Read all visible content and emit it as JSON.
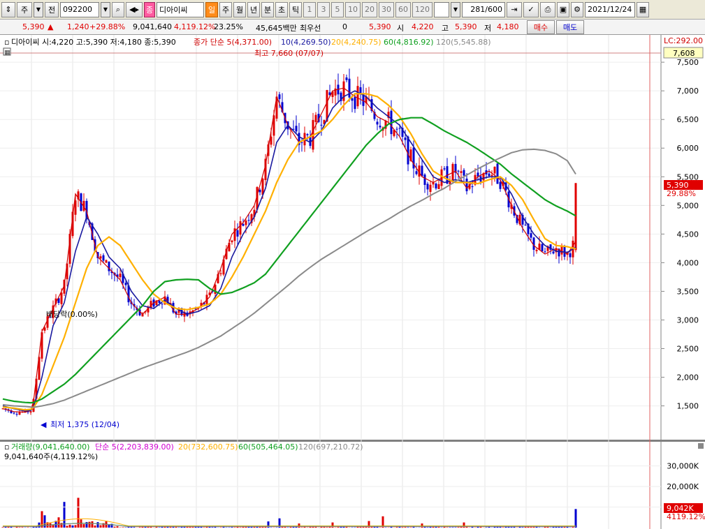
{
  "toolbar": {
    "market": "주",
    "jeon": "전",
    "code": "092200",
    "sector_badge": "종",
    "name": "디아이씨",
    "periods": [
      "일",
      "주",
      "월",
      "년",
      "분",
      "초",
      "틱"
    ],
    "minutes": [
      "1",
      "3",
      "5",
      "10",
      "20",
      "30",
      "60",
      "120"
    ],
    "count": "281",
    "count_total": "/600",
    "date": "2021/12/24"
  },
  "quote": {
    "price": "5,390",
    "change": "1,240",
    "change_pct": "+29.88%",
    "volume": "9,041,640",
    "vol_ratio": "4,119.12%",
    "turnover": "23.25%",
    "amount": "45,645백만",
    "best_label": "최우선",
    "best_value": "0",
    "last": "5,390",
    "open_label": "시",
    "open": "4,220",
    "high_label": "고",
    "high": "5,390",
    "low_label": "저",
    "low": "4,180",
    "buy_button": "매수",
    "sell_button": "매도"
  },
  "price_panel": {
    "title": "디아이씨 시:4,220 고:5,390 저:4,180 종:5,390",
    "ma5": "종가 단순 5(4,371.00)",
    "ma10": "10(4,269.50)",
    "ma20": "20(4,240.75)",
    "ma60": "60(4,816.92)",
    "ma120": "120(5,545.88)",
    "lc_label": "LC:292.00",
    "hi_marker": "7,608",
    "high_annotation": "최고 7,660 (07/07)",
    "low_annotation": "최저 1,375 (12/04)",
    "dividend_annotation": "배당락(0.00%)",
    "price_badge": "5,390",
    "price_badge_pct": "29.88%",
    "y_ticks": [
      "7,500",
      "7,000",
      "6,500",
      "6,000",
      "5,500",
      "5,000",
      "4,500",
      "4,000",
      "3,500",
      "3,000",
      "2,500",
      "2,000",
      "1,500"
    ]
  },
  "volume_panel": {
    "title": "거래량(9,041,640.00)",
    "ma5": "단순 5(2,203,839.00)",
    "ma20": "20(732,600.75)",
    "ma60": "60(505,464.05)",
    "ma120": "120(697,210.72)",
    "current": "9,041,640주(4,119.12%)",
    "y_ticks": [
      "30,000K",
      "20,000K",
      "10,000K"
    ],
    "badge": "9,042K",
    "badge_pct": "4119.12%"
  },
  "colors": {
    "up": "#e00000",
    "down": "#0000d0",
    "ma5": "#d00000",
    "ma10": "#1a1aa0",
    "ma20": "#ffb000",
    "ma60": "#10a020",
    "ma120": "#8a8a8a",
    "badge": "#e00000",
    "hi_marker_bg": "#ffffc0"
  },
  "chart_data": {
    "type": "candlestick",
    "ylim": [
      1300,
      7660
    ],
    "high": 7660,
    "low": 1375,
    "close": 5390,
    "ma_anchor": [
      [
        0,
        1450,
        1500,
        1480,
        1620,
        1520
      ],
      [
        4,
        1400,
        1450,
        1460,
        1580,
        1500
      ],
      [
        8,
        1390,
        1410,
        1430,
        1560,
        1490
      ],
      [
        10,
        1420,
        1420,
        1440,
        1555,
        1480
      ],
      [
        11,
        1580,
        1480,
        1470,
        1560,
        1475
      ],
      [
        14,
        2800,
        2000,
        1700,
        1620,
        1500
      ],
      [
        18,
        3200,
        2900,
        2200,
        1750,
        1540
      ],
      [
        22,
        3600,
        3300,
        2700,
        1880,
        1600
      ],
      [
        26,
        5200,
        4200,
        3300,
        2050,
        1680
      ],
      [
        30,
        4900,
        4800,
        3900,
        2250,
        1760
      ],
      [
        34,
        4100,
        4500,
        4300,
        2450,
        1840
      ],
      [
        38,
        3900,
        4100,
        4450,
        2650,
        1920
      ],
      [
        42,
        3700,
        3900,
        4300,
        2850,
        2000
      ],
      [
        46,
        3300,
        3500,
        4000,
        3050,
        2080
      ],
      [
        50,
        3100,
        3250,
        3700,
        3250,
        2160
      ],
      [
        54,
        3300,
        3200,
        3450,
        3500,
        2230
      ],
      [
        58,
        3400,
        3350,
        3300,
        3670,
        2300
      ],
      [
        62,
        3100,
        3200,
        3200,
        3700,
        2370
      ],
      [
        66,
        3100,
        3100,
        3180,
        3710,
        2440
      ],
      [
        70,
        3200,
        3150,
        3220,
        3700,
        2520
      ],
      [
        74,
        3400,
        3250,
        3280,
        3550,
        2620
      ],
      [
        78,
        3900,
        3550,
        3450,
        3450,
        2720
      ],
      [
        82,
        4500,
        4100,
        3750,
        3480,
        2850
      ],
      [
        86,
        4700,
        4500,
        4100,
        3560,
        2980
      ],
      [
        90,
        5000,
        4800,
        4500,
        3650,
        3120
      ],
      [
        94,
        5700,
        5300,
        4900,
        3800,
        3280
      ],
      [
        98,
        6900,
        6100,
        5400,
        4050,
        3440
      ],
      [
        102,
        6400,
        6400,
        5800,
        4300,
        3600
      ],
      [
        106,
        6100,
        6200,
        6100,
        4550,
        3770
      ],
      [
        110,
        6200,
        6100,
        6200,
        4800,
        3920
      ],
      [
        114,
        6600,
        6300,
        6300,
        5050,
        4060
      ],
      [
        118,
        7000,
        6700,
        6500,
        5300,
        4180
      ],
      [
        122,
        7050,
        6900,
        6750,
        5550,
        4300
      ],
      [
        126,
        6900,
        7000,
        6950,
        5800,
        4420
      ],
      [
        130,
        6800,
        6900,
        6950,
        6050,
        4540
      ],
      [
        134,
        6550,
        6700,
        6900,
        6250,
        4650
      ],
      [
        138,
        6450,
        6550,
        6750,
        6420,
        4760
      ],
      [
        142,
        6200,
        6400,
        6550,
        6500,
        4880
      ],
      [
        146,
        5800,
        6100,
        6250,
        6530,
        4990
      ],
      [
        150,
        5500,
        5800,
        5900,
        6530,
        5090
      ],
      [
        154,
        5400,
        5500,
        5600,
        6420,
        5200
      ],
      [
        158,
        5500,
        5400,
        5480,
        6300,
        5300
      ],
      [
        162,
        5600,
        5450,
        5400,
        6200,
        5420
      ],
      [
        166,
        5300,
        5400,
        5400,
        6100,
        5530
      ],
      [
        170,
        5500,
        5450,
        5380,
        5980,
        5640
      ],
      [
        174,
        5600,
        5500,
        5450,
        5850,
        5740
      ],
      [
        178,
        5450,
        5500,
        5500,
        5720,
        5830
      ],
      [
        182,
        5000,
        5200,
        5350,
        5550,
        5920
      ],
      [
        186,
        4600,
        4800,
        5100,
        5400,
        5970
      ],
      [
        190,
        4300,
        4500,
        4750,
        5250,
        5980
      ],
      [
        194,
        4150,
        4300,
        4420,
        5100,
        5960
      ],
      [
        198,
        4250,
        4200,
        4300,
        4990,
        5900
      ],
      [
        202,
        4150,
        4180,
        4280,
        4900,
        5780
      ],
      [
        205,
        4371,
        4270,
        4241,
        4817,
        5546
      ]
    ],
    "series": [
      {
        "name": "종가 단순 5(4,371.00)",
        "field": 1
      },
      {
        "name": "10(4,269.50)",
        "field": 2
      },
      {
        "name": "20(4,240.75)",
        "field": 3
      },
      {
        "name": "60(4,816.92)",
        "field": 4
      },
      {
        "name": "120(5,545.88)",
        "field": 5
      }
    ],
    "candles_count": 206,
    "volume_ylim": [
      0,
      36000000
    ],
    "volume_spikes": [
      [
        14,
        8.0
      ],
      [
        15,
        6.0
      ],
      [
        20,
        5.0
      ],
      [
        22,
        12.5
      ],
      [
        27,
        14.5
      ],
      [
        28,
        4.0
      ],
      [
        95,
        3.0
      ],
      [
        118,
        2.5
      ],
      [
        99,
        4.5
      ],
      [
        136,
        5.5
      ],
      [
        106,
        2.0
      ],
      [
        131,
        3.2
      ],
      [
        150,
        2.0
      ],
      [
        165,
        2.5
      ],
      [
        205,
        9.04
      ]
    ]
  }
}
